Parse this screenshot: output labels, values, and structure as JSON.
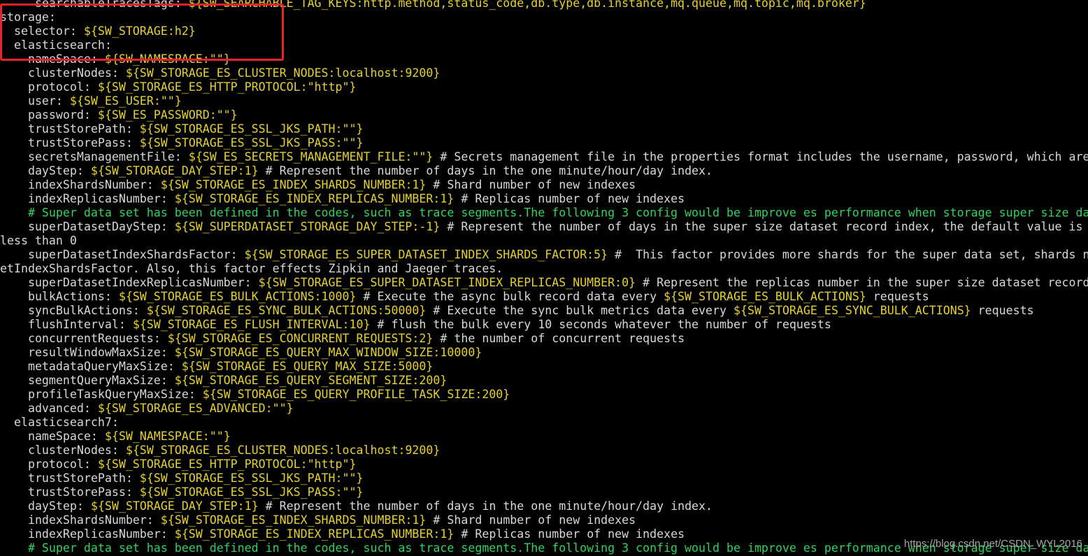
{
  "terminal": {
    "lines": [
      [
        {
          "t": "      searchableTracesTags: ",
          "c": "k"
        },
        {
          "t": "${SW_SEARCHABLE_TAG_KEYS:http.method,status_code,db.type,db.instance,mq.queue,mq.topic,mq.broker}",
          "c": "v"
        }
      ],
      [
        {
          "t": " storage:",
          "c": "k"
        }
      ],
      [
        {
          "t": "   selector: ",
          "c": "k"
        },
        {
          "t": "${SW_STORAGE:h2}",
          "c": "v"
        }
      ],
      [
        {
          "t": "   elasticsearch:",
          "c": "k"
        }
      ],
      [
        {
          "t": "     nameSpace: ",
          "c": "k"
        },
        {
          "t": "${SW_NAMESPACE:\"\"}",
          "c": "v"
        }
      ],
      [
        {
          "t": "     clusterNodes: ",
          "c": "k"
        },
        {
          "t": "${SW_STORAGE_ES_CLUSTER_NODES:localhost:9200}",
          "c": "v"
        }
      ],
      [
        {
          "t": "     protocol: ",
          "c": "k"
        },
        {
          "t": "${SW_STORAGE_ES_HTTP_PROTOCOL:\"http\"}",
          "c": "v"
        }
      ],
      [
        {
          "t": "     user: ",
          "c": "k"
        },
        {
          "t": "${SW_ES_USER:\"\"}",
          "c": "v"
        }
      ],
      [
        {
          "t": "     password: ",
          "c": "k"
        },
        {
          "t": "${SW_ES_PASSWORD:\"\"}",
          "c": "v"
        }
      ],
      [
        {
          "t": "     trustStorePath: ",
          "c": "k"
        },
        {
          "t": "${SW_STORAGE_ES_SSL_JKS_PATH:\"\"}",
          "c": "v"
        }
      ],
      [
        {
          "t": "     trustStorePass: ",
          "c": "k"
        },
        {
          "t": "${SW_STORAGE_ES_SSL_JKS_PASS:\"\"}",
          "c": "v"
        }
      ],
      [
        {
          "t": "     secretsManagementFile: ",
          "c": "k"
        },
        {
          "t": "${SW_ES_SECRETS_MANAGEMENT_FILE:\"\"}",
          "c": "v"
        },
        {
          "t": " # Secrets management file in the properties format includes the username, password, which are",
          "c": "c"
        }
      ],
      [
        {
          "t": "     dayStep: ",
          "c": "k"
        },
        {
          "t": "${SW_STORAGE_DAY_STEP:1}",
          "c": "v"
        },
        {
          "t": " # Represent the number of days in the one minute/hour/day index.",
          "c": "c"
        }
      ],
      [
        {
          "t": "     indexShardsNumber: ",
          "c": "k"
        },
        {
          "t": "${SW_STORAGE_ES_INDEX_SHARDS_NUMBER:1}",
          "c": "v"
        },
        {
          "t": " # Shard number of new indexes",
          "c": "c"
        }
      ],
      [
        {
          "t": "     indexReplicasNumber: ",
          "c": "k"
        },
        {
          "t": "${SW_STORAGE_ES_INDEX_REPLICAS_NUMBER:1}",
          "c": "v"
        },
        {
          "t": " # Replicas number of new indexes",
          "c": "c"
        }
      ],
      [
        {
          "t": "     # Super data set has been defined in the codes, such as trace segments.The following 3 config would be improve es performance when storage super size da",
          "c": "g"
        }
      ],
      [
        {
          "t": "     superDatasetDayStep: ",
          "c": "k"
        },
        {
          "t": "${SW_SUPERDATASET_STORAGE_DAY_STEP:-1}",
          "c": "v"
        },
        {
          "t": " # Represent the number of days in the super size dataset record index, the default value is",
          "c": "c"
        }
      ],
      [
        {
          "t": " less than 0",
          "c": "k"
        }
      ],
      [
        {
          "t": "     superDatasetIndexShardsFactor: ",
          "c": "k"
        },
        {
          "t": "${SW_STORAGE_ES_SUPER_DATASET_INDEX_SHARDS_FACTOR:5}",
          "c": "v"
        },
        {
          "t": " #  This factor provides more shards for the super data set, shards n",
          "c": "c"
        }
      ],
      [
        {
          "t": "setIndexShardsFactor. Also, this factor effects Zipkin and Jaeger traces.",
          "c": "k"
        }
      ],
      [
        {
          "t": "     superDatasetIndexReplicasNumber: ",
          "c": "k"
        },
        {
          "t": "${SW_STORAGE_ES_SUPER_DATASET_INDEX_REPLICAS_NUMBER:0}",
          "c": "v"
        },
        {
          "t": " # Represent the replicas number in the super size dataset record",
          "c": "c"
        }
      ],
      [
        {
          "t": "     bulkActions: ",
          "c": "k"
        },
        {
          "t": "${SW_STORAGE_ES_BULK_ACTIONS:1000}",
          "c": "v"
        },
        {
          "t": " # Execute the async bulk record data every ",
          "c": "c"
        },
        {
          "t": "${SW_STORAGE_ES_BULK_ACTIONS}",
          "c": "v"
        },
        {
          "t": " requests",
          "c": "c"
        }
      ],
      [
        {
          "t": "     syncBulkActions: ",
          "c": "k"
        },
        {
          "t": "${SW_STORAGE_ES_SYNC_BULK_ACTIONS:50000}",
          "c": "v"
        },
        {
          "t": " # Execute the sync bulk metrics data every ",
          "c": "c"
        },
        {
          "t": "${SW_STORAGE_ES_SYNC_BULK_ACTIONS}",
          "c": "v"
        },
        {
          "t": " requests",
          "c": "c"
        }
      ],
      [
        {
          "t": "     flushInterval: ",
          "c": "k"
        },
        {
          "t": "${SW_STORAGE_ES_FLUSH_INTERVAL:10}",
          "c": "v"
        },
        {
          "t": " # flush the bulk every 10 seconds whatever the number of requests",
          "c": "c"
        }
      ],
      [
        {
          "t": "     concurrentRequests: ",
          "c": "k"
        },
        {
          "t": "${SW_STORAGE_ES_CONCURRENT_REQUESTS:2}",
          "c": "v"
        },
        {
          "t": " # the number of concurrent requests",
          "c": "c"
        }
      ],
      [
        {
          "t": "     resultWindowMaxSize: ",
          "c": "k"
        },
        {
          "t": "${SW_STORAGE_ES_QUERY_MAX_WINDOW_SIZE:10000}",
          "c": "v"
        }
      ],
      [
        {
          "t": "     metadataQueryMaxSize: ",
          "c": "k"
        },
        {
          "t": "${SW_STORAGE_ES_QUERY_MAX_SIZE:5000}",
          "c": "v"
        }
      ],
      [
        {
          "t": "     segmentQueryMaxSize: ",
          "c": "k"
        },
        {
          "t": "${SW_STORAGE_ES_QUERY_SEGMENT_SIZE:200}",
          "c": "v"
        }
      ],
      [
        {
          "t": "     profileTaskQueryMaxSize: ",
          "c": "k"
        },
        {
          "t": "${SW_STORAGE_ES_QUERY_PROFILE_TASK_SIZE:200}",
          "c": "v"
        }
      ],
      [
        {
          "t": "     advanced: ",
          "c": "k"
        },
        {
          "t": "${SW_STORAGE_ES_ADVANCED:\"\"}",
          "c": "v"
        }
      ],
      [
        {
          "t": "   elasticsearch7:",
          "c": "k"
        }
      ],
      [
        {
          "t": "     nameSpace: ",
          "c": "k"
        },
        {
          "t": "${SW_NAMESPACE:\"\"}",
          "c": "v"
        }
      ],
      [
        {
          "t": "     clusterNodes: ",
          "c": "k"
        },
        {
          "t": "${SW_STORAGE_ES_CLUSTER_NODES:localhost:9200}",
          "c": "v"
        }
      ],
      [
        {
          "t": "     protocol: ",
          "c": "k"
        },
        {
          "t": "${SW_STORAGE_ES_HTTP_PROTOCOL:\"http\"}",
          "c": "v"
        }
      ],
      [
        {
          "t": "     trustStorePath: ",
          "c": "k"
        },
        {
          "t": "${SW_STORAGE_ES_SSL_JKS_PATH:\"\"}",
          "c": "v"
        }
      ],
      [
        {
          "t": "     trustStorePass: ",
          "c": "k"
        },
        {
          "t": "${SW_STORAGE_ES_SSL_JKS_PASS:\"\"}",
          "c": "v"
        }
      ],
      [
        {
          "t": "     dayStep: ",
          "c": "k"
        },
        {
          "t": "${SW_STORAGE_DAY_STEP:1}",
          "c": "v"
        },
        {
          "t": " # Represent the number of days in the one minute/hour/day index.",
          "c": "c"
        }
      ],
      [
        {
          "t": "     indexShardsNumber: ",
          "c": "k"
        },
        {
          "t": "${SW_STORAGE_ES_INDEX_SHARDS_NUMBER:1}",
          "c": "v"
        },
        {
          "t": " # Shard number of new indexes",
          "c": "c"
        }
      ],
      [
        {
          "t": "     indexReplicasNumber: ",
          "c": "k"
        },
        {
          "t": "${SW_STORAGE_ES_INDEX_REPLICAS_NUMBER:1}",
          "c": "v"
        },
        {
          "t": " # Replicas number of new indexes",
          "c": "c"
        }
      ],
      [
        {
          "t": "     # Super data set has been defined in the codes, such as trace segments.The following 3 config would be improve es performance when storage super size da",
          "c": "g"
        }
      ]
    ]
  },
  "watermark": "https://blog.csdn.net/CSDN_WYL2016",
  "colors": {
    "background": "#000000",
    "key_text": "#d8d8d8",
    "env_value": "#e6d12b",
    "comment_green": "#2fd35d",
    "highlight_box": "#e8232a"
  }
}
